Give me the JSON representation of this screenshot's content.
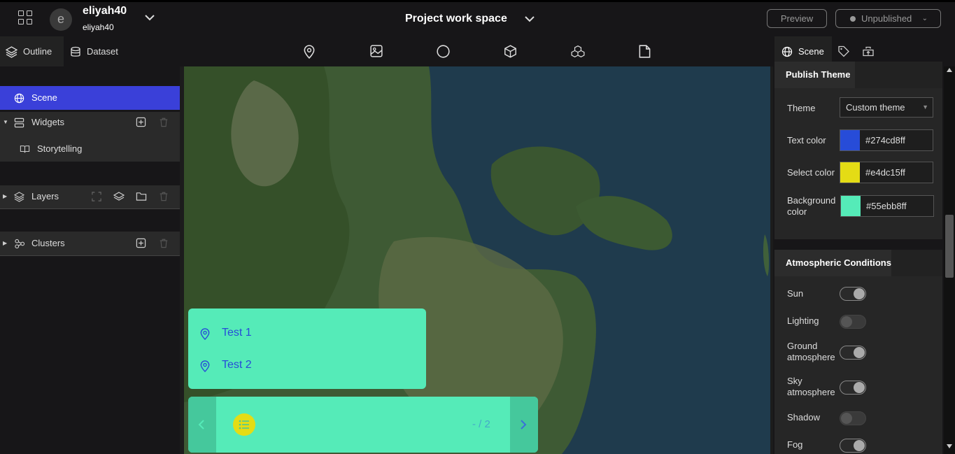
{
  "header": {
    "user_initial": "e",
    "user_name": "eliyah40",
    "user_sub": "eliyah40",
    "project_title": "Project work space",
    "preview_label": "Preview",
    "publish_status": "Unpublished"
  },
  "left_panel": {
    "tabs": [
      {
        "label": "Outline"
      },
      {
        "label": "Dataset"
      }
    ],
    "scene_label": "Scene",
    "widgets_label": "Widgets",
    "storytelling_label": "Storytelling",
    "layers_label": "Layers",
    "clusters_label": "Clusters"
  },
  "toolbar": {
    "icons": [
      "map-pin-icon",
      "image-icon",
      "circle-icon",
      "cube-icon",
      "cubes-icon",
      "file-icon"
    ]
  },
  "storytelling": {
    "items": [
      {
        "label": "Test 1"
      },
      {
        "label": "Test 2"
      }
    ],
    "pager": "- / 2"
  },
  "right_panel": {
    "tab_label": "Scene",
    "publish_theme": {
      "title": "Publish Theme",
      "theme_label": "Theme",
      "theme_value": "Custom theme",
      "text_color_label": "Text color",
      "text_color": "#274cd8ff",
      "select_color_label": "Select color",
      "select_color": "#e4dc15ff",
      "background_color_label": "Background color",
      "background_color": "#55ebb8ff"
    },
    "atmosphere": {
      "title": "Atmospheric Conditions",
      "toggles": [
        {
          "label": "Sun",
          "on": true
        },
        {
          "label": "Lighting",
          "on": false
        },
        {
          "label": "Ground atmosphere",
          "on": true
        },
        {
          "label": "Sky atmosphere",
          "on": true
        },
        {
          "label": "Shadow",
          "on": false
        },
        {
          "label": "Fog",
          "on": true
        }
      ]
    }
  },
  "colors": {
    "accent": "#3a40d9",
    "text_color": "#274cd8",
    "select_color": "#e4dc15",
    "background_color": "#55ebb8"
  }
}
